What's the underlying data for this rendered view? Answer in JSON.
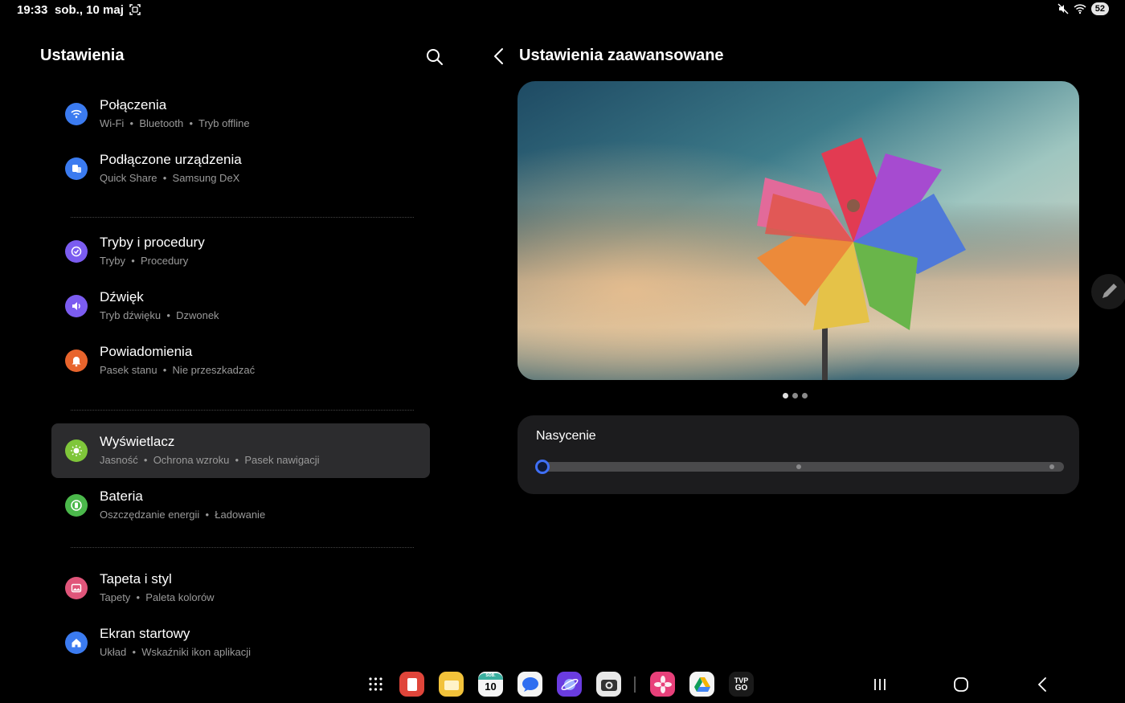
{
  "status_bar": {
    "time": "19:33",
    "date": "sob., 10 maj",
    "battery": "52"
  },
  "left_pane": {
    "title": "Ustawienia",
    "items": [
      {
        "title": "Połączenia",
        "subtitle": "Wi-Fi  •  Bluetooth  •  Tryb offline",
        "icon": "wifi-icon",
        "color": "#3b7bf0"
      },
      {
        "title": "Podłączone urządzenia",
        "subtitle": "Quick Share  •  Samsung DeX",
        "icon": "connected-devices-icon",
        "color": "#3b7bf0"
      },
      {
        "title": "Tryby i procedury",
        "subtitle": "Tryby  •  Procedury",
        "icon": "modes-routines-icon",
        "color": "#7b5cf0"
      },
      {
        "title": "Dźwięk",
        "subtitle": "Tryb dźwięku  •  Dzwonek",
        "icon": "sound-icon",
        "color": "#7b5cf0"
      },
      {
        "title": "Powiadomienia",
        "subtitle": "Pasek stanu  •  Nie przeszkadzać",
        "icon": "bell-icon",
        "color": "#e8642c"
      },
      {
        "title": "Wyświetlacz",
        "subtitle": "Jasność  •  Ochrona wzroku  •  Pasek nawigacji",
        "icon": "sun-icon",
        "color": "#7fc63a",
        "active": true
      },
      {
        "title": "Bateria",
        "subtitle": "Oszczędzanie energii  •  Ładowanie",
        "icon": "battery-icon",
        "color": "#4bb84b"
      },
      {
        "title": "Tapeta i styl",
        "subtitle": "Tapety  •  Paleta kolorów",
        "icon": "wallpaper-icon",
        "color": "#e0557a"
      },
      {
        "title": "Ekran startowy",
        "subtitle": "Układ  •  Wskaźniki ikon aplikacji",
        "icon": "home-icon",
        "color": "#3b7bf0"
      }
    ]
  },
  "right_pane": {
    "title": "Ustawienia zaawansowane",
    "preview_pages": 3,
    "preview_active_page": 1,
    "saturation": {
      "label": "Nasycenie",
      "value": 0,
      "steps": 3
    }
  },
  "taskbar": {
    "apps": [
      "apps-grid-icon",
      "notes-app-icon",
      "files-app-icon",
      "calendar-app-icon",
      "messages-app-icon",
      "internet-app-icon",
      "camera-app-icon",
      "gallery-app-icon",
      "drive-app-icon",
      "tvp-go-app-icon"
    ],
    "calendar_day": "10",
    "calendar_weekday": "SOB.",
    "tvp_label_top": "TVP",
    "tvp_label_bottom": "GO"
  },
  "colors": {
    "background": "#000000",
    "selected_item": "#2c2c2e",
    "card": "#1c1c1e",
    "accent": "#3f6ff5"
  }
}
